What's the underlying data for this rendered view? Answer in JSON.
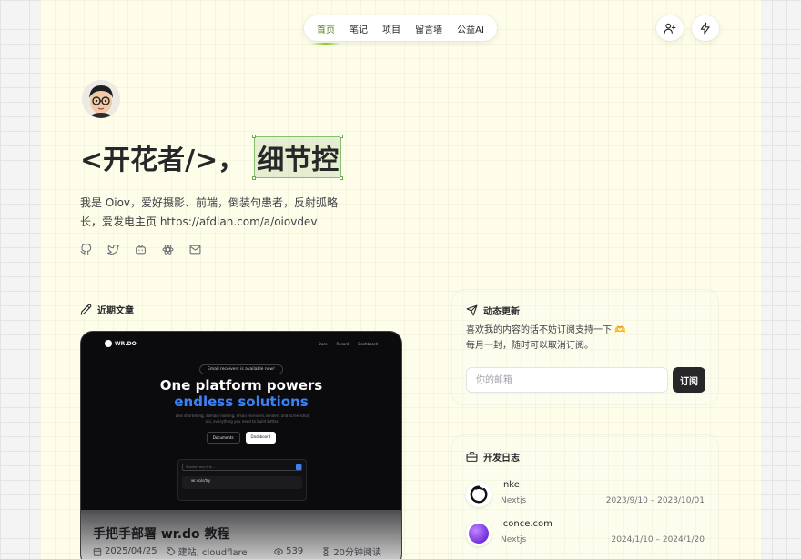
{
  "nav": {
    "items": [
      {
        "label": "首页",
        "active": true
      },
      {
        "label": "笔记",
        "active": false
      },
      {
        "label": "项目",
        "active": false
      },
      {
        "label": "留言墙",
        "active": false
      },
      {
        "label": "公益AI",
        "active": false
      }
    ],
    "icons": [
      "user-plus-icon",
      "lightning-icon"
    ]
  },
  "hero": {
    "headline_prefix": "<开花者/>，",
    "headline_highlight": "细节控",
    "bio": "我是 Oiov，爱好摄影、前端，倒装句患者，反射弧略长，爱发电主页 https://afdian.com/a/oiovdev",
    "social_icons": [
      "github-icon",
      "twitter-icon",
      "bilibili-icon",
      "atom-icon",
      "mail-icon"
    ]
  },
  "recent_posts": {
    "title": "近期文章",
    "card": {
      "title": "手把手部署 wr.do 教程",
      "date": "2025/04/25",
      "tags": "建站, cloudflare",
      "views": "539",
      "read_time": "20分钟阅读",
      "screenshot": {
        "logo": "WR.DO",
        "links": [
          "Docs",
          "Record",
          "Dashboard"
        ],
        "pill": "Email receivers is available now!",
        "heading_line1": "One platform powers",
        "heading_line2": "endless solutions",
        "subtext": "Link shortening, domain hosting, email receivers,senders and screenshot api, everything you need to build better.",
        "btn_docs": "Documents",
        "btn_dashboard": "Dashboard",
        "input_placeholder": "Shorten any link...",
        "row_text": "wr.do/s/try"
      }
    }
  },
  "newsletter": {
    "title": "动态更新",
    "text_line1": "喜欢我的内容的话不妨订阅支持一下 🫶",
    "text_line2": "每月一封，随时可以取消订阅。",
    "placeholder": "你的邮箱",
    "button": "订阅"
  },
  "devlog": {
    "title": "开发日志",
    "items": [
      {
        "name": "Inke",
        "tech": "Nextjs",
        "date": "2023/9/10 – 2023/10/01"
      },
      {
        "name": "iconce.com",
        "tech": "Nextjs",
        "date": "2024/1/10 – 2024/1/20"
      }
    ]
  }
}
